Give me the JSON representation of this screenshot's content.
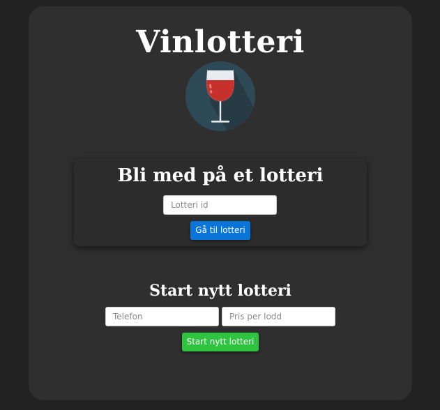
{
  "header": {
    "title": "Vinlotteri",
    "logo_icon": "wine-glass-icon"
  },
  "join": {
    "heading": "Bli med på et lotteri",
    "input_placeholder": "Lotteri id",
    "input_value": "",
    "button_label": "Gå til lotteri"
  },
  "start": {
    "heading": "Start nytt lotteri",
    "phone_placeholder": "Telefon",
    "phone_value": "",
    "price_placeholder": "Pris per lodd",
    "price_value": "",
    "button_label": "Start nytt lotteri"
  },
  "colors": {
    "background": "#222222",
    "card": "#2f2f2f",
    "primary_button": "#0a75d8",
    "success_button": "#2ec440",
    "logo_circle": "#2f4a57",
    "wine": "#c8302c"
  }
}
